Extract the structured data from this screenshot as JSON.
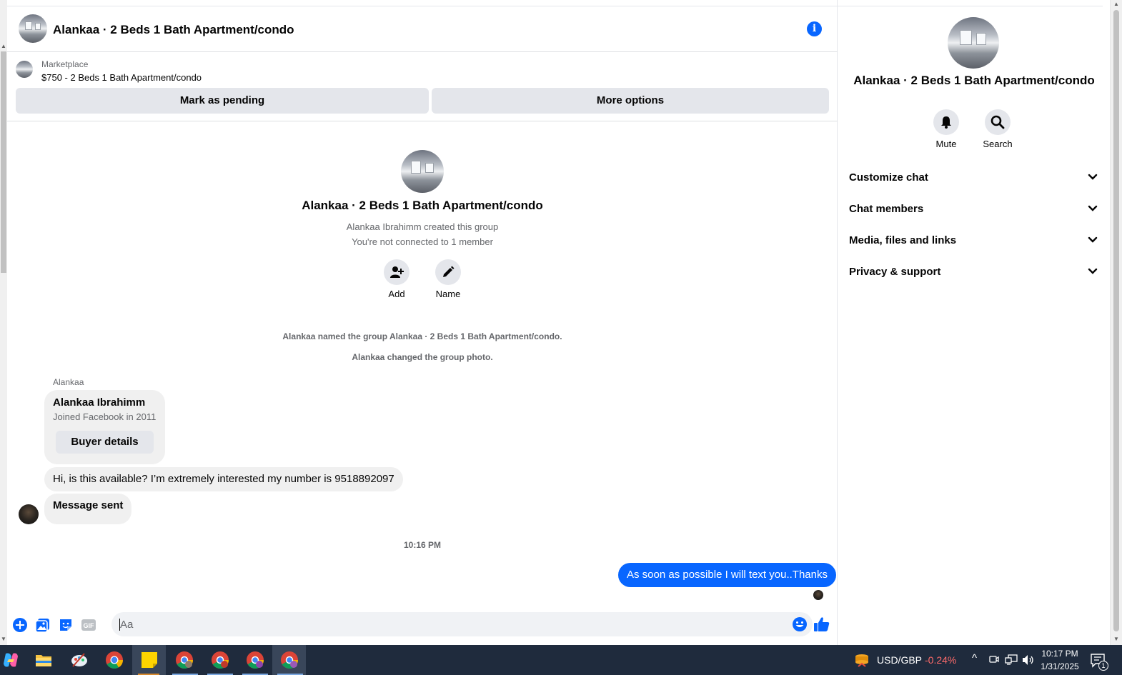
{
  "header": {
    "title": "Alankaa · 2 Beds 1 Bath Apartment/condo",
    "info_icon": "info-icon"
  },
  "marketplace": {
    "label": "Marketplace",
    "listing": "$750 - 2 Beds 1 Bath Apartment/condo",
    "mark_pending": "Mark as pending",
    "more_options": "More options"
  },
  "intro": {
    "title": "Alankaa · 2 Beds 1 Bath Apartment/condo",
    "created": "Alankaa Ibrahimm created this group",
    "connected": "You're not connected to 1 member",
    "add_label": "Add",
    "name_label": "Name"
  },
  "system": {
    "named": "Alankaa named the group Alankaa · 2 Beds 1 Bath Apartment/condo.",
    "photo": "Alankaa changed the group photo."
  },
  "messages": {
    "sender": "Alankaa",
    "card_name": "Alankaa Ibrahimm",
    "card_joined": "Joined Facebook in 2011",
    "card_button": "Buyer details",
    "msg1": "Hi, is this available? I’m extremely interested my number is 9518892097",
    "msg2": "Message sent",
    "time": "10:16 PM",
    "reply": "As soon as possible I will text you..Thanks"
  },
  "composer": {
    "placeholder": "Aa",
    "value": ""
  },
  "panel": {
    "title": "Alankaa · 2 Beds 1 Bath Apartment/condo",
    "mute": "Mute",
    "search": "Search",
    "sections": [
      "Customize chat",
      "Chat members",
      "Media, files and links",
      "Privacy & support"
    ]
  },
  "taskbar": {
    "ticker": "USD/GBP",
    "change": "-0.24%",
    "time": "10:17 PM",
    "date": "1/31/2025",
    "notifications": "1"
  },
  "colors": {
    "accent": "#0866ff",
    "bubble_in": "#f0f0f0",
    "taskbar": "#1f2b3d",
    "negative": "#ff6b6b"
  }
}
